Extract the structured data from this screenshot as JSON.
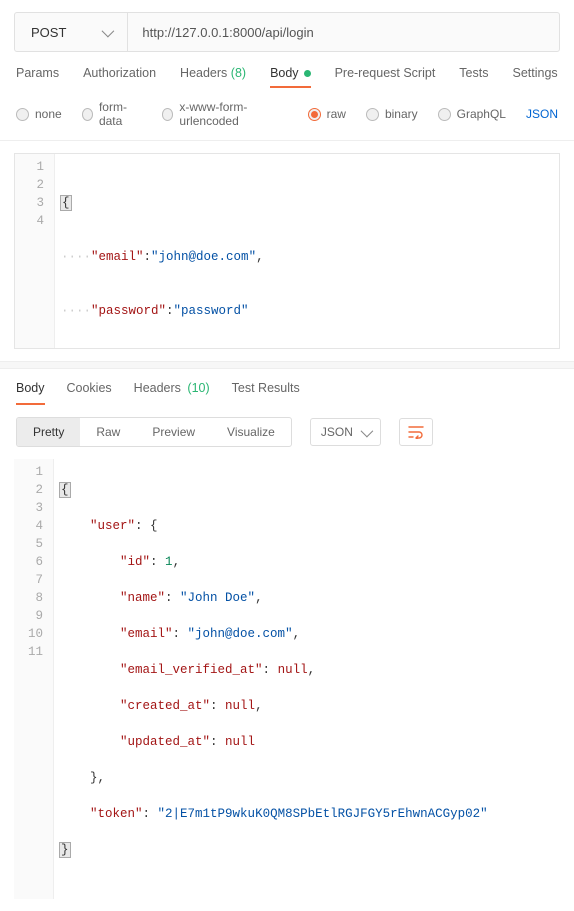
{
  "request": {
    "method": "POST",
    "url": "http://127.0.0.1:8000/api/login"
  },
  "req_tabs": {
    "params": "Params",
    "auth": "Authorization",
    "headers": "Headers",
    "headers_count": "(8)",
    "body": "Body",
    "prerequest": "Pre-request Script",
    "tests": "Tests",
    "settings": "Settings"
  },
  "body_types": {
    "none": "none",
    "formdata": "form-data",
    "xform": "x-www-form-urlencoded",
    "raw": "raw",
    "binary": "binary",
    "graphql": "GraphQL",
    "format": "JSON"
  },
  "request_body": {
    "email_key": "\"email\"",
    "email_val": "\"john@doe.com\"",
    "password_key": "\"password\"",
    "password_val": "\"password\""
  },
  "resp_tabs": {
    "body": "Body",
    "cookies": "Cookies",
    "headers": "Headers",
    "headers_count": "(10)",
    "tests": "Test Results"
  },
  "views": {
    "pretty": "Pretty",
    "raw": "Raw",
    "preview": "Preview",
    "visualize": "Visualize",
    "format": "JSON"
  },
  "response_body": {
    "user_key": "\"user\"",
    "id_key": "\"id\"",
    "id_val": "1",
    "name_key": "\"name\"",
    "name_val": "\"John Doe\"",
    "email_key": "\"email\"",
    "email_val": "\"john@doe.com\"",
    "emailv_key": "\"email_verified_at\"",
    "created_key": "\"created_at\"",
    "updated_key": "\"updated_at\"",
    "null": "null",
    "token_key": "\"token\"",
    "token_val": "\"2|E7m1tP9wkuK0QM8SPbEtlRGJFGY5rEhwnACGyp02\""
  }
}
